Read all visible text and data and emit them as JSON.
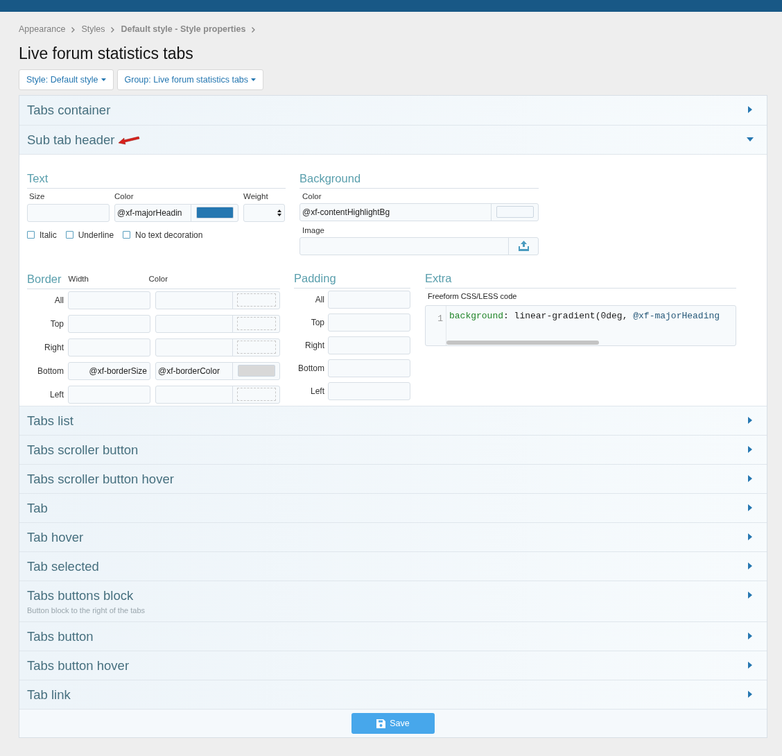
{
  "breadcrumb": [
    {
      "label": "Appearance",
      "bold": false
    },
    {
      "label": "Styles",
      "bold": false
    },
    {
      "label": "Default style - Style properties",
      "bold": true
    }
  ],
  "title": "Live forum statistics tabs",
  "filters": [
    "Style: Default style",
    "Group: Live forum statistics tabs"
  ],
  "sections": [
    {
      "title": "Tabs container",
      "expanded": false
    },
    {
      "title": "Sub tab header",
      "expanded": true,
      "properties": {
        "text": {
          "heading": "Text",
          "size_label": "Size",
          "color_label": "Color",
          "color_value": "@xf-majorHeadin",
          "color": "#2577b1",
          "weight_label": "Weight",
          "options": [
            {
              "label": "Italic",
              "checked": false
            },
            {
              "label": "Underline",
              "checked": false
            },
            {
              "label": "No text decoration",
              "checked": false
            }
          ]
        },
        "background": {
          "heading": "Background",
          "color_label": "Color",
          "color_value": "@xf-contentHighlightBg",
          "color": "#f5f9fc",
          "image_label": "Image"
        },
        "border": {
          "heading": "Border",
          "width_label": "Width",
          "color_label": "Color",
          "rows": [
            {
              "label": "All"
            },
            {
              "label": "Top"
            },
            {
              "label": "Right"
            },
            {
              "label": "Bottom",
              "width": "@xf-borderSize",
              "color_value": "@xf-borderColor",
              "color": "#d8d8d8"
            },
            {
              "label": "Left"
            }
          ]
        },
        "padding": {
          "heading": "Padding",
          "rows": [
            "All",
            "Top",
            "Right",
            "Bottom",
            "Left"
          ]
        },
        "extra": {
          "heading": "Extra",
          "label": "Freeform CSS/LESS code",
          "line_number": "1",
          "tokens": [
            {
              "text": "background",
              "kind": "property"
            },
            {
              "text": ": linear-gradient(0deg, ",
              "kind": "plain"
            },
            {
              "text": "@xf-majorHeading",
              "kind": "variable"
            }
          ]
        }
      }
    },
    {
      "title": "Tabs list",
      "expanded": false
    },
    {
      "title": "Tabs scroller button",
      "expanded": false
    },
    {
      "title": "Tabs scroller button hover",
      "expanded": false
    },
    {
      "title": "Tab",
      "expanded": false
    },
    {
      "title": "Tab hover",
      "expanded": false
    },
    {
      "title": "Tab selected",
      "expanded": false
    },
    {
      "title": "Tabs buttons block",
      "description": "Button block to the right of the tabs",
      "expanded": false
    },
    {
      "title": "Tabs button",
      "expanded": false
    },
    {
      "title": "Tabs button hover",
      "expanded": false
    },
    {
      "title": "Tab link",
      "expanded": false
    }
  ],
  "save_label": "Save"
}
